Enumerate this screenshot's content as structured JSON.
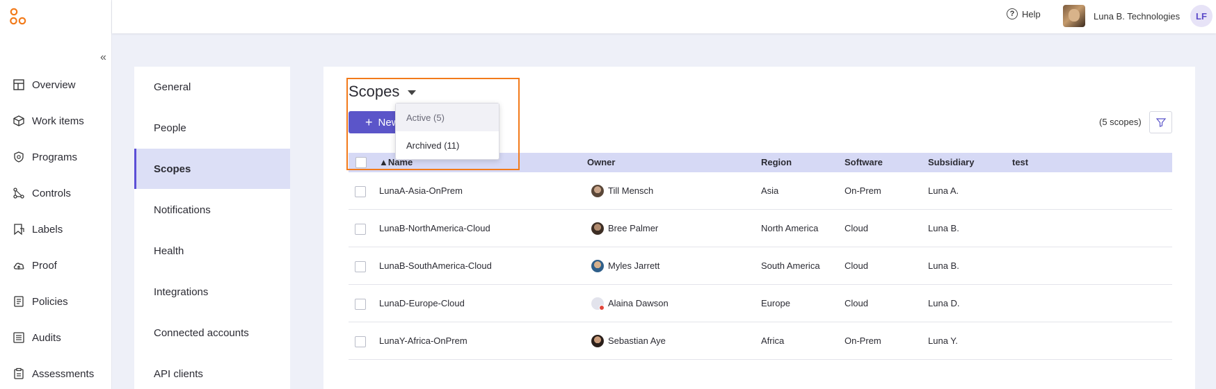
{
  "nav": {
    "collapse_icon": "double-chevron-left-icon",
    "items": [
      {
        "label": "Overview",
        "icon": "dashboard-icon"
      },
      {
        "label": "Work items",
        "icon": "box-icon"
      },
      {
        "label": "Programs",
        "icon": "shield-icon"
      },
      {
        "label": "Controls",
        "icon": "controls-icon"
      },
      {
        "label": "Labels",
        "icon": "tag-icon"
      },
      {
        "label": "Proof",
        "icon": "cloud-upload-icon"
      },
      {
        "label": "Policies",
        "icon": "policy-icon"
      },
      {
        "label": "Audits",
        "icon": "audit-icon"
      },
      {
        "label": "Assessments",
        "icon": "clipboard-icon"
      }
    ]
  },
  "header": {
    "help_label": "Help",
    "org_name": "Luna B. Technologies",
    "user_initials": "LF"
  },
  "settings_nav": {
    "items": [
      "General",
      "People",
      "Scopes",
      "Notifications",
      "Health",
      "Integrations",
      "Connected accounts",
      "API clients"
    ],
    "active": "Scopes"
  },
  "scopes": {
    "title": "Scopes",
    "new_button": "New",
    "count_text": "(5 scopes)",
    "dropdown": [
      "Active (5)",
      "Archived (11)"
    ],
    "columns": [
      "▲Name",
      "Owner",
      "Region",
      "Software",
      "Subsidiary",
      "test"
    ],
    "rows": [
      {
        "name": "LunaA-Asia-OnPrem",
        "owner": "Till Mensch",
        "region": "Asia",
        "software": "On-Prem",
        "subsidiary": "Luna A.",
        "test": ""
      },
      {
        "name": "LunaB-NorthAmerica-Cloud",
        "owner": "Bree Palmer",
        "region": "North America",
        "software": "Cloud",
        "subsidiary": "Luna B.",
        "test": ""
      },
      {
        "name": "LunaB-SouthAmerica-Cloud",
        "owner": "Myles Jarrett",
        "region": "South America",
        "software": "Cloud",
        "subsidiary": "Luna B.",
        "test": ""
      },
      {
        "name": "LunaD-Europe-Cloud",
        "owner": "Alaina Dawson",
        "region": "Europe",
        "software": "Cloud",
        "subsidiary": "Luna D.",
        "test": ""
      },
      {
        "name": "LunaY-Africa-OnPrem",
        "owner": "Sebastian Aye",
        "region": "Africa",
        "software": "On-Prem",
        "subsidiary": "Luna Y.",
        "test": ""
      }
    ]
  },
  "colors": {
    "accent": "#5b55c9",
    "logo": "#f27a1a",
    "highlight": "#f27a1a",
    "header_row": "#d6d9f5"
  }
}
